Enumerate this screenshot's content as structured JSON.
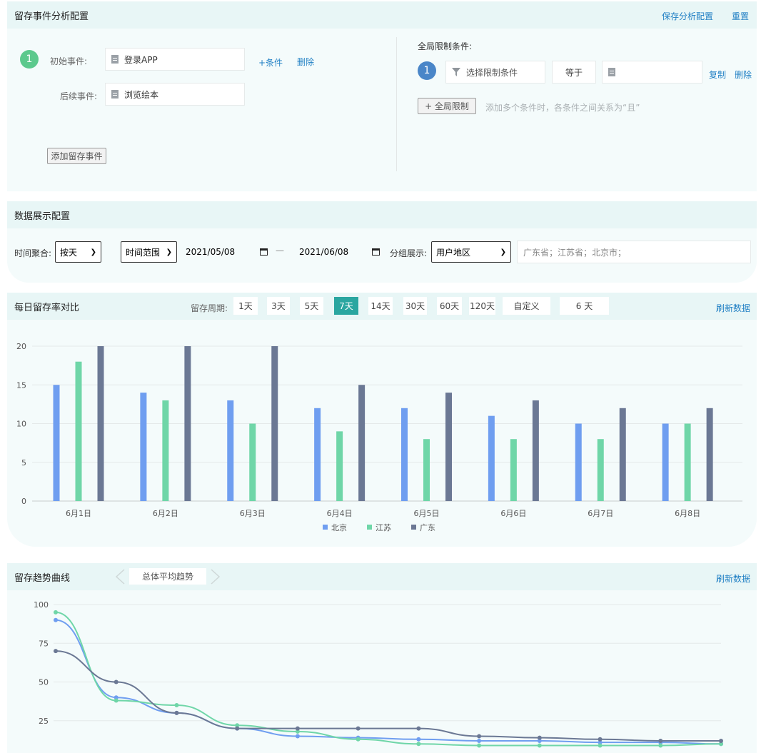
{
  "config": {
    "title": "留存事件分析配置",
    "save_label": "保存分析配置",
    "reset_label": "重置",
    "step_number": "1",
    "initial_label": "初始事件:",
    "initial_value": "登录APP",
    "add_condition": "+条件",
    "delete_label": "删除",
    "followup_label": "后续事件:",
    "followup_value": "浏览绘本",
    "add_event_button": "添加留存事件",
    "global_title": "全局限制条件:",
    "global_step": "1",
    "select_condition_placeholder": "选择限制条件",
    "operator": "等于",
    "copy_label": "复制",
    "global_delete_label": "删除",
    "global_add_button": "+ 全局限制",
    "global_hint": "添加多个条件时，各条件之间关系为“且”"
  },
  "display": {
    "title": "数据展示配置",
    "time_agg_label": "时间聚合:",
    "time_agg_value": "按天",
    "range_select": "时间范围",
    "date_start": "2021/05/08",
    "date_sep": "—",
    "date_end": "2021/06/08",
    "group_label": "分组展示:",
    "group_value": "用户地区",
    "group_items": "广东省；江苏省；北京市；"
  },
  "daily": {
    "title": "每日留存率对比",
    "period_label": "留存周期:",
    "periods": [
      "1天",
      "3天",
      "5天",
      "7天",
      "14天",
      "30天",
      "60天",
      "120天",
      "自定义"
    ],
    "active_period": "7天",
    "custom_value": "6 天",
    "refresh": "刷新数据"
  },
  "trend": {
    "title": "留存趋势曲线",
    "selector": "总体平均趋势",
    "refresh": "刷新数据"
  },
  "colors": {
    "beijing": "#6f9ef0",
    "jiangsu": "#6fd6a8",
    "guangdong": "#6b7894",
    "accent": "#2aa6a0",
    "link": "#1f7fc4"
  },
  "chart_data": [
    {
      "type": "bar",
      "categories": [
        "6月1日",
        "6月2日",
        "6月3日",
        "6月4日",
        "6月5日",
        "6月6日",
        "6月7日",
        "6月8日"
      ],
      "series": [
        {
          "name": "北京",
          "values": [
            15,
            14,
            13,
            12,
            12,
            11,
            10,
            10
          ]
        },
        {
          "name": "江苏",
          "values": [
            18,
            13,
            10,
            9,
            8,
            8,
            8,
            10
          ]
        },
        {
          "name": "广东",
          "values": [
            20,
            20,
            20,
            15,
            14,
            13,
            12,
            12
          ]
        }
      ],
      "yticks": [
        "0",
        "5",
        "10",
        "15",
        "20"
      ],
      "ylim": [
        0,
        20
      ],
      "grid": true,
      "legend": "bottom"
    },
    {
      "type": "line",
      "series": [
        {
          "values": [
            90,
            40,
            30,
            20,
            15,
            14,
            13,
            12,
            12,
            11,
            11,
            10
          ]
        },
        {
          "values": [
            95,
            38,
            35,
            22,
            18,
            13,
            10,
            9,
            9,
            9,
            9,
            10
          ]
        },
        {
          "values": [
            70,
            50,
            30,
            20,
            20,
            20,
            20,
            15,
            14,
            13,
            12,
            12
          ]
        }
      ],
      "yticks": [
        "25",
        "50",
        "75",
        "100"
      ],
      "ylim": [
        0,
        100
      ],
      "grid": true
    }
  ]
}
